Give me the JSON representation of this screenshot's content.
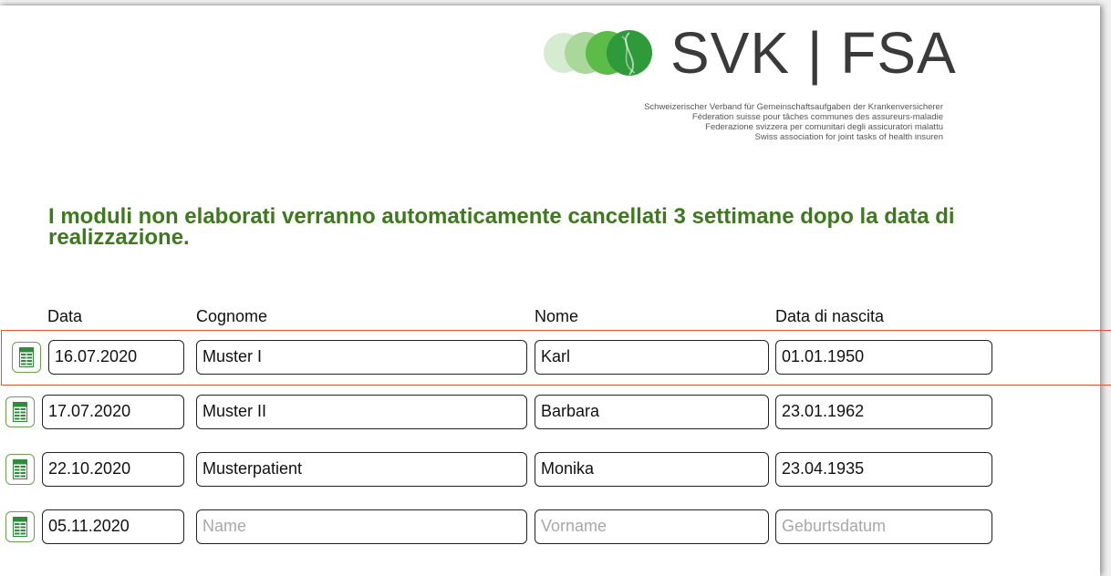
{
  "logo": {
    "text": "SVK | FSA",
    "tagline": [
      "Schweizerischer Verband für Gemeinschaftsaufgaben der Krankenversicherer",
      "Féderation suisse pour tâches communes des assureurs-maladie",
      "Federazione svizzera per comunitari degli assicuratori malattu",
      "Swiss association for joint tasks of health insuren"
    ]
  },
  "notice": "I moduli non elaborati verranno automaticamente cancellati 3 settimane dopo la data di realizzazione.",
  "columns": {
    "date": "Data",
    "surname": "Cognome",
    "name": "Nome",
    "birth": "Data di nascita"
  },
  "rows": [
    {
      "date": "16.07.2020",
      "surname": "Muster I",
      "name": "Karl",
      "birth": "01.01.1950",
      "selected": true
    },
    {
      "date": "17.07.2020",
      "surname": "Muster II",
      "name": "Barbara",
      "birth": "23.01.1962",
      "selected": false
    },
    {
      "date": "22.10.2020",
      "surname": "Musterpatient",
      "name": "Monika",
      "birth": "23.04.1935",
      "selected": false
    },
    {
      "date": "05.11.2020",
      "surname": "",
      "name": "",
      "birth": "",
      "selected": false
    }
  ],
  "placeholders": {
    "surname": "Name",
    "name": "Vorname",
    "birth": "Geburtsdatum"
  },
  "colors": {
    "accent_green": "#3d7a1e",
    "selection_border": "#e85040",
    "icon_green": "#2e8b3a"
  },
  "icons": {
    "row_button": "spreadsheet-document-icon",
    "logo": "svk-logo-circles-icon"
  }
}
